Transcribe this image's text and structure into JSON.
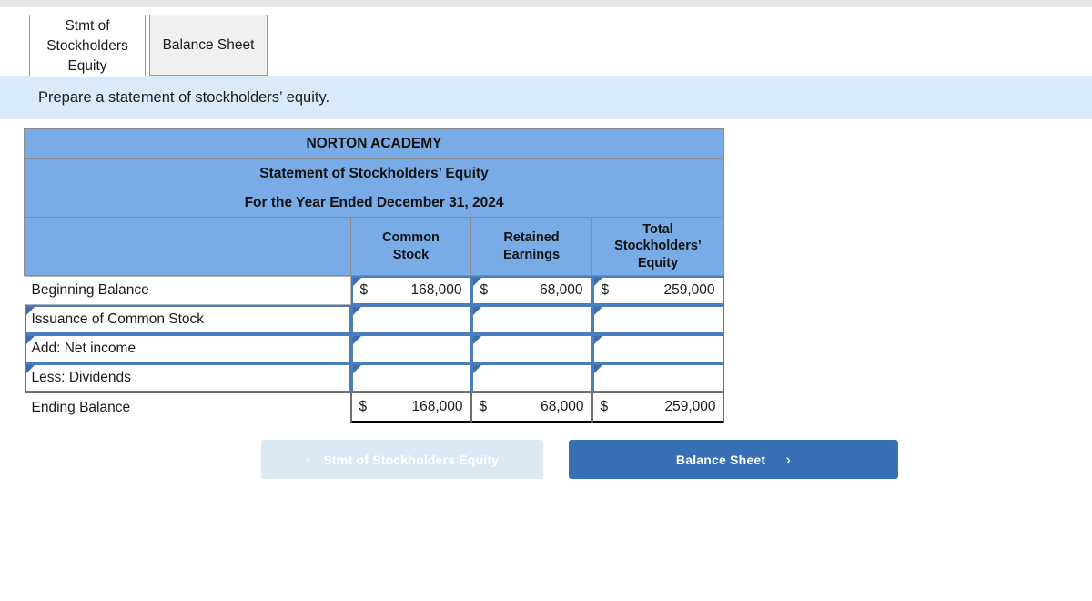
{
  "tabs": [
    {
      "label": "Stmt of Stockholders Equity",
      "active": true
    },
    {
      "label": "Balance Sheet",
      "active": false
    }
  ],
  "instruction": {
    "text": "Prepare a statement of stockholders’ equity."
  },
  "statement": {
    "company": "NORTON ACADEMY",
    "title": "Statement of Stockholders’ Equity",
    "period": "For the Year Ended December 31, 2024",
    "columns": [
      {
        "line1": "",
        "line2": "",
        "line3": ""
      },
      {
        "line1": "Common",
        "line2": "Stock",
        "line3": ""
      },
      {
        "line1": "Retained",
        "line2": "Earnings",
        "line3": ""
      },
      {
        "line1": "Total",
        "line2": "Stockholders’",
        "line3": "Equity"
      }
    ],
    "rows": [
      {
        "label": "Beginning Balance",
        "label_editable": false,
        "cells_editable": true,
        "is_total": false,
        "common_stock": {
          "symbol": "$",
          "value": "168,000"
        },
        "retained_earnings": {
          "symbol": "$",
          "value": "68,000"
        },
        "total_equity": {
          "symbol": "$",
          "value": "259,000"
        }
      },
      {
        "label": "Issuance of Common Stock",
        "label_editable": true,
        "cells_editable": true,
        "is_total": false,
        "common_stock": {
          "symbol": "",
          "value": ""
        },
        "retained_earnings": {
          "symbol": "",
          "value": ""
        },
        "total_equity": {
          "symbol": "",
          "value": ""
        }
      },
      {
        "label": "Add: Net income",
        "label_editable": true,
        "cells_editable": true,
        "is_total": false,
        "common_stock": {
          "symbol": "",
          "value": ""
        },
        "retained_earnings": {
          "symbol": "",
          "value": ""
        },
        "total_equity": {
          "symbol": "",
          "value": ""
        }
      },
      {
        "label": "Less: Dividends",
        "label_editable": true,
        "cells_editable": true,
        "is_total": false,
        "common_stock": {
          "symbol": "",
          "value": ""
        },
        "retained_earnings": {
          "symbol": "",
          "value": ""
        },
        "total_equity": {
          "symbol": "",
          "value": ""
        }
      },
      {
        "label": "Ending Balance",
        "label_editable": false,
        "cells_editable": false,
        "is_total": true,
        "common_stock": {
          "symbol": "$",
          "value": "168,000"
        },
        "retained_earnings": {
          "symbol": "$",
          "value": "68,000"
        },
        "total_equity": {
          "symbol": "$",
          "value": "259,000"
        }
      }
    ]
  },
  "nav": {
    "prev": {
      "label": "Stmt of Stockholders Equity",
      "icon": "chevron-left-icon",
      "glyph": "‹",
      "disabled": true
    },
    "next": {
      "label": "Balance Sheet",
      "icon": "chevron-right-icon",
      "glyph": "›",
      "disabled": false
    }
  },
  "colors": {
    "header_blue": "#79ACE6",
    "banner_blue": "#D9EBF9",
    "input_border_blue": "#4A7EBB",
    "primary_button": "#3770B4",
    "disabled_button": "#DCE8F2"
  }
}
